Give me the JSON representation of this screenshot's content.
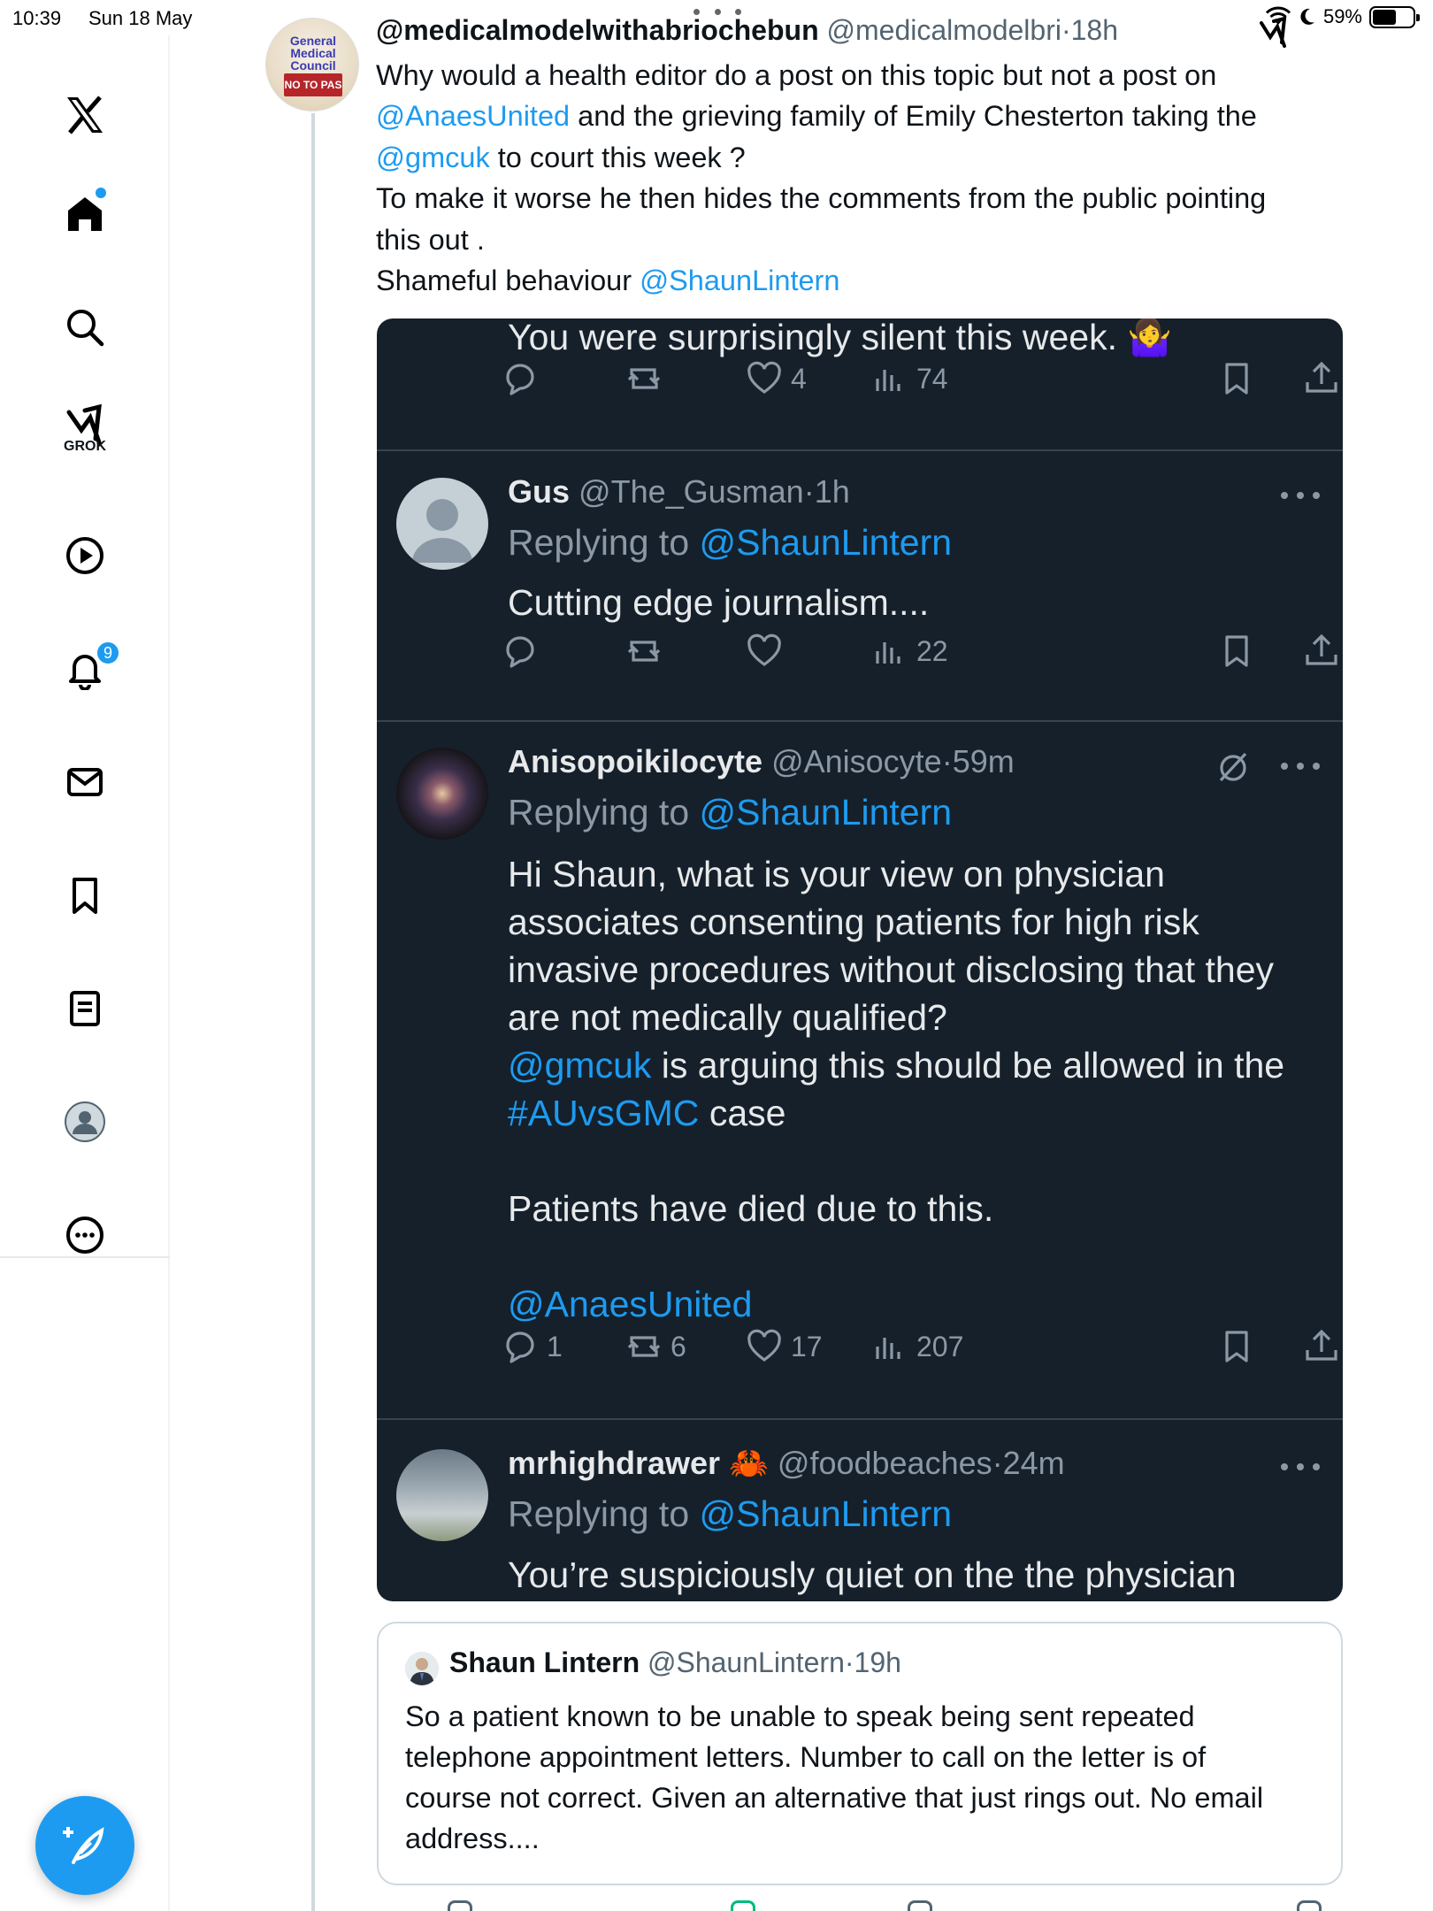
{
  "status_bar": {
    "time": "10:39",
    "date": "Sun 18 May",
    "battery": "59%",
    "battery_level": 0.59
  },
  "nav": {
    "notification_count": "9",
    "grok_label": "GROK",
    "items": [
      "x-logo",
      "home-icon",
      "search-icon",
      "grok-icon",
      "video-icon",
      "notifications-icon",
      "messages-icon",
      "bookmarks-icon",
      "lists-icon",
      "profile-icon",
      "more-icon"
    ]
  },
  "tweet": {
    "author_name": "@medicalmodelwithabriochebun",
    "author_handle": "@medicalmodelbri",
    "age": "18h",
    "avatar_text": "General Medical Council",
    "avatar_stamp": "NO TO PAS",
    "text": {
      "l1": "Why would a health editor do a post on this topic but not a post on",
      "l2_mention": "@AnaesUnited",
      "l2_rest": " and the grieving family of Emily Chesterton taking the",
      "l3_mention": "@gmcuk",
      "l3_rest": " to court this week ?",
      "l4": "To make it worse he then hides the comments from the public pointing",
      "l5": "this out .",
      "l6_pre": "Shameful behaviour ",
      "l6_mention": "@ShaunLintern"
    }
  },
  "screenshot": {
    "top_text": "You were surprisingly silent this week. 🤷‍♀️",
    "top_actions": {
      "likes": "4",
      "views": "74"
    },
    "replies": [
      {
        "name": "Gus",
        "handle": "@The_Gusman",
        "age": "1h",
        "replying_prefix": "Replying to ",
        "replying_to": "@ShaunLintern",
        "body": "Cutting edge journalism....",
        "views": "22"
      },
      {
        "name": "Anisopoikilocyte",
        "handle": "@Anisocyte",
        "age": "59m",
        "replying_prefix": "Replying to ",
        "replying_to": "@ShaunLintern",
        "body_l1": "Hi Shaun, what is your view on physician",
        "body_l2": "associates consenting patients for high risk",
        "body_l3": "invasive procedures without disclosing that they",
        "body_l4": "are not medically qualified?",
        "body_l5_mention": "@gmcuk",
        "body_l5_rest": " is arguing this should be allowed in the",
        "body_l6_tag": "#AUvsGMC",
        "body_l6_rest": " case",
        "body_l7": "Patients have died due to this.",
        "body_l8_mention": "@AnaesUnited",
        "replies": "1",
        "reposts": "6",
        "likes": "17",
        "views": "207"
      },
      {
        "name": "mrhighdrawer",
        "emoji": "🦀",
        "handle": "@foodbeaches",
        "age": "24m",
        "replying_prefix": "Replying to ",
        "replying_to": "@ShaunLintern",
        "body": "You’re suspiciously quiet on the the physician"
      }
    ]
  },
  "quote": {
    "name": "Shaun Lintern",
    "handle": "@ShaunLintern",
    "age": "19h",
    "l1": "So a patient known to be unable to speak being sent repeated",
    "l2": "telephone appointment letters. Number to call on the letter is of",
    "l3": "course not correct. Given an alternative that just rings out. No email",
    "l4": "address...."
  },
  "colors": {
    "accent": "#1d9bf0",
    "dark_bg": "#15202b",
    "muted": "#536471"
  }
}
